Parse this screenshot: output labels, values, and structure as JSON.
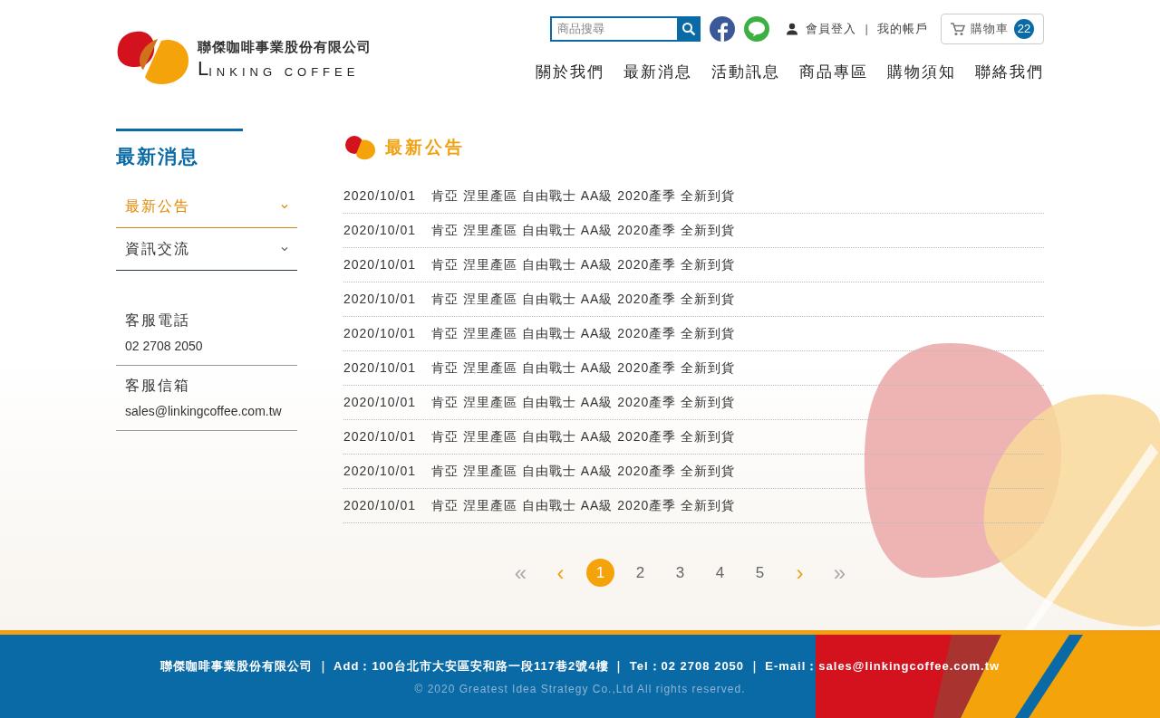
{
  "logo": {
    "company": "聯傑咖啡事業股份有限公司",
    "brand_initial": "L",
    "brand_rest": "INKING COFFEE"
  },
  "header": {
    "search": {
      "placeholder": "商品搜尋"
    },
    "login": "會員登入",
    "separator": "|",
    "account": "我的帳戶",
    "cart": {
      "label": "購物車",
      "count": "22"
    }
  },
  "nav": [
    "關於我們",
    "最新消息",
    "活動訊息",
    "商品專區",
    "購物須知",
    "聯絡我們"
  ],
  "sidebar": {
    "title": "最新消息",
    "items": [
      {
        "label": "最新公告",
        "selected": true
      },
      {
        "label": "資訊交流",
        "selected": false
      }
    ],
    "contacts": [
      {
        "label": "客服電話",
        "value": "02 2708 2050"
      },
      {
        "label": "客服信箱",
        "value": "sales@linkingcoffee.com.tw"
      }
    ]
  },
  "main": {
    "heading": "最新公告",
    "news": [
      {
        "date": "2020/10/01",
        "title": "肯亞 涅里產區 自由戰士 AA級 2020產季 全新到貨"
      },
      {
        "date": "2020/10/01",
        "title": "肯亞 涅里產區 自由戰士 AA級 2020產季 全新到貨"
      },
      {
        "date": "2020/10/01",
        "title": "肯亞 涅里產區 自由戰士 AA級 2020產季 全新到貨"
      },
      {
        "date": "2020/10/01",
        "title": "肯亞 涅里產區 自由戰士 AA級 2020產季 全新到貨"
      },
      {
        "date": "2020/10/01",
        "title": "肯亞 涅里產區 自由戰士 AA級 2020產季 全新到貨"
      },
      {
        "date": "2020/10/01",
        "title": "肯亞 涅里產區 自由戰士 AA級 2020產季 全新到貨"
      },
      {
        "date": "2020/10/01",
        "title": "肯亞 涅里產區 自由戰士 AA級 2020產季 全新到貨"
      },
      {
        "date": "2020/10/01",
        "title": "肯亞 涅里產區 自由戰士 AA級 2020產季 全新到貨"
      },
      {
        "date": "2020/10/01",
        "title": "肯亞 涅里產區 自由戰士 AA級 2020產季 全新到貨"
      },
      {
        "date": "2020/10/01",
        "title": "肯亞 涅里產區 自由戰士 AA級 2020產季 全新到貨"
      }
    ],
    "pagination": [
      {
        "kind": "first",
        "label": "«",
        "disabled": true
      },
      {
        "kind": "prev",
        "label": "‹",
        "disabled": false
      },
      {
        "kind": "page",
        "label": "1",
        "selected": true
      },
      {
        "kind": "page",
        "label": "2",
        "selected": false
      },
      {
        "kind": "page",
        "label": "3",
        "selected": false
      },
      {
        "kind": "page",
        "label": "4",
        "selected": false
      },
      {
        "kind": "page",
        "label": "5",
        "selected": false
      },
      {
        "kind": "next",
        "label": "›",
        "disabled": false
      },
      {
        "kind": "last",
        "label": "»",
        "disabled": true
      }
    ]
  },
  "footer": {
    "info": "聯傑咖啡事業股份有限公司 ｜ Add：100台北市大安區安和路一段117巷2號4樓 ｜ Tel：02 2708 2050 ｜ E-mail：sales@linkingcoffee.com.tw",
    "copyright": "© 2020 Greatest Idea Strategy Co.,Ltd All rights reserved."
  }
}
